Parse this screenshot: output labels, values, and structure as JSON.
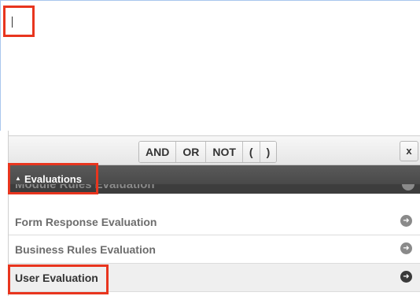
{
  "toolbar": {
    "operators": [
      "AND",
      "OR",
      "NOT",
      "(",
      ")"
    ],
    "close_label": "x"
  },
  "section": {
    "title": "Evaluations",
    "peek_item": "Module Rules Evaluation"
  },
  "evaluations": [
    {
      "label": "Form Response Evaluation",
      "selected": false
    },
    {
      "label": "Business Rules Evaluation",
      "selected": false
    },
    {
      "label": "User Evaluation",
      "selected": true
    }
  ],
  "colors": {
    "highlight": "#e8351e",
    "section_header": "#4a4a4a",
    "editor_border": "#a9c7ee"
  },
  "icons": {
    "expand": "triangle-up-icon",
    "row_action": "circle-chevron-right-icon"
  }
}
